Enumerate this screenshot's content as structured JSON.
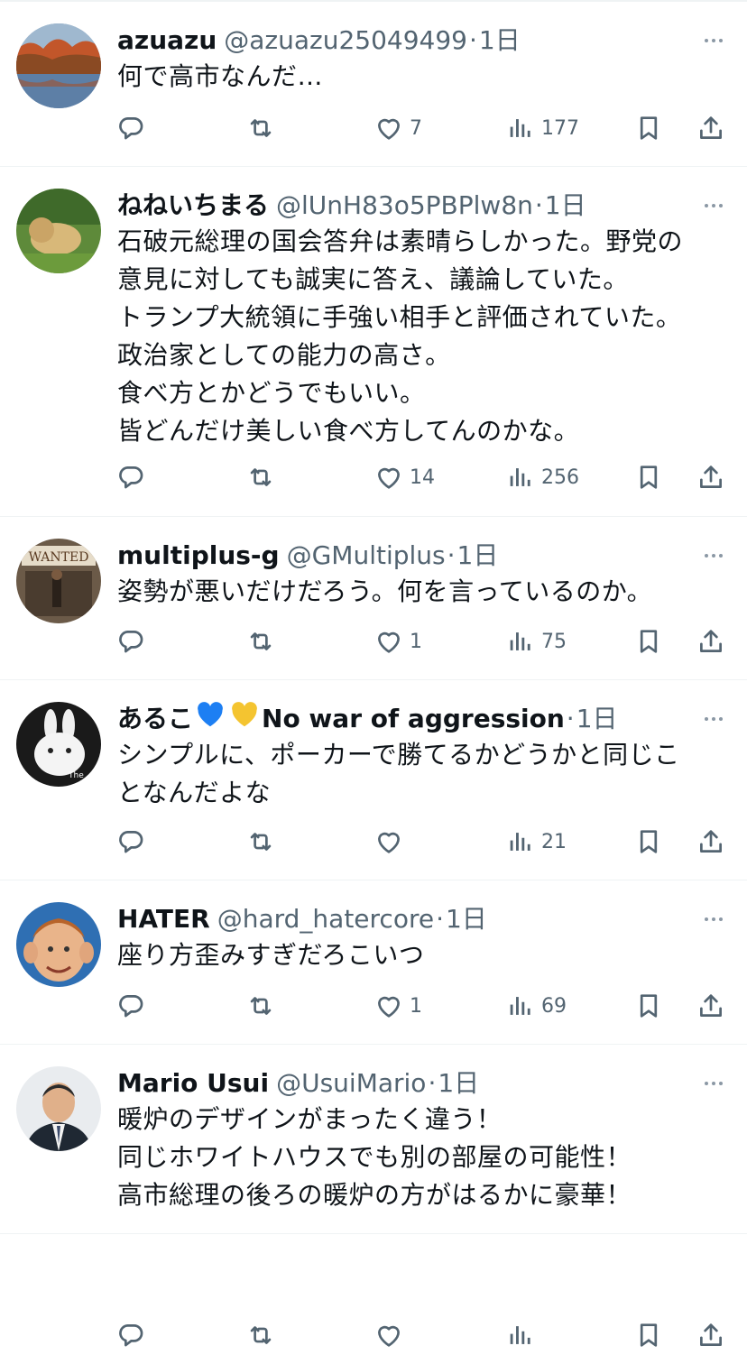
{
  "colors": {
    "text": "#0f1419",
    "muted": "#536471",
    "divider": "#eff3f4",
    "blue_heart": "#1d7ff3",
    "yellow_heart": "#f4c430"
  },
  "icons": {
    "reply": "reply-icon",
    "retweet": "retweet-icon",
    "like": "like-icon",
    "views": "views-icon",
    "bookmark": "bookmark-icon",
    "share": "share-icon",
    "more": "more-icon"
  },
  "tweets": [
    {
      "name": "azuazu",
      "handle": "@azuazu25049499",
      "time": "1日",
      "text": "何で高市なんだ…",
      "replies": "",
      "retweets": "",
      "likes": "7",
      "views": "177"
    },
    {
      "name": "ねねいちまる",
      "handle": "@lUnH83o5PBPlw8n",
      "time": "1日",
      "text": "石破元総理の国会答弁は素晴らしかった。野党の\n意見に対しても誠実に答え、議論していた。\nトランプ大統領に手強い相手と評価されていた。\n政治家としての能力の高さ。\n食べ方とかどうでもいい。\n皆どんだけ美しい食べ方してんのかな。",
      "replies": "",
      "retweets": "",
      "likes": "14",
      "views": "256"
    },
    {
      "name": "multiplus-g",
      "handle": "@GMultiplus",
      "time": "1日",
      "text": "姿勢が悪いだけだろう。何を言っているのか。",
      "replies": "",
      "retweets": "",
      "likes": "1",
      "views": "75"
    },
    {
      "name": "あるこ",
      "name_suffix": "No war of aggression",
      "handle": "",
      "time": "1日",
      "text": "シンプルに、ポーカーで勝てるかどうかと同じこ\nとなんだよな",
      "replies": "",
      "retweets": "",
      "likes": "",
      "views": "21"
    },
    {
      "name": "HATER",
      "handle": "@hard_hatercore",
      "time": "1日",
      "text": "座り方歪みすぎだろこいつ",
      "replies": "",
      "retweets": "",
      "likes": "1",
      "views": "69"
    },
    {
      "name": "Mario Usui",
      "handle": "@UsuiMario",
      "time": "1日",
      "text": "暖炉のデザインがまったく違う！\n同じホワイトハウスでも別の部屋の可能性！\n高市総理の後ろの暖炉の方がはるかに豪華！",
      "replies": "",
      "retweets": "",
      "likes": "",
      "views": ""
    }
  ]
}
